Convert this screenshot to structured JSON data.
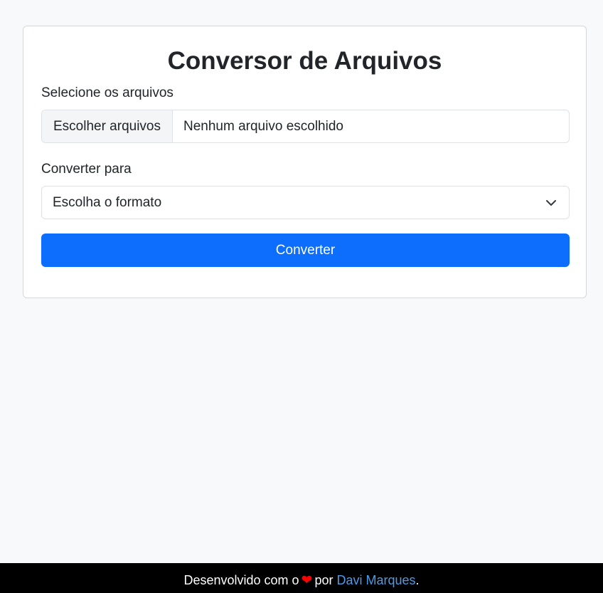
{
  "card": {
    "title": "Conversor de Arquivos",
    "file_label": "Selecione os arquivos",
    "file_button_label": "Escolher arquivos",
    "file_status": "Nenhum arquivo escolhido",
    "format_label": "Converter para",
    "format_select_value": "Escolha o formato",
    "convert_button_label": "Converter"
  },
  "footer": {
    "text_before": "Desenvolvido com o",
    "heart_icon": "heart-icon",
    "text_middle": "por",
    "author_link": "Davi Marques",
    "text_after": "."
  },
  "colors": {
    "background": "#f8f9fa",
    "primary": "#0d6efd",
    "footer_bg": "#000000",
    "heart": "#ff0000",
    "link": "#4d9be6"
  }
}
